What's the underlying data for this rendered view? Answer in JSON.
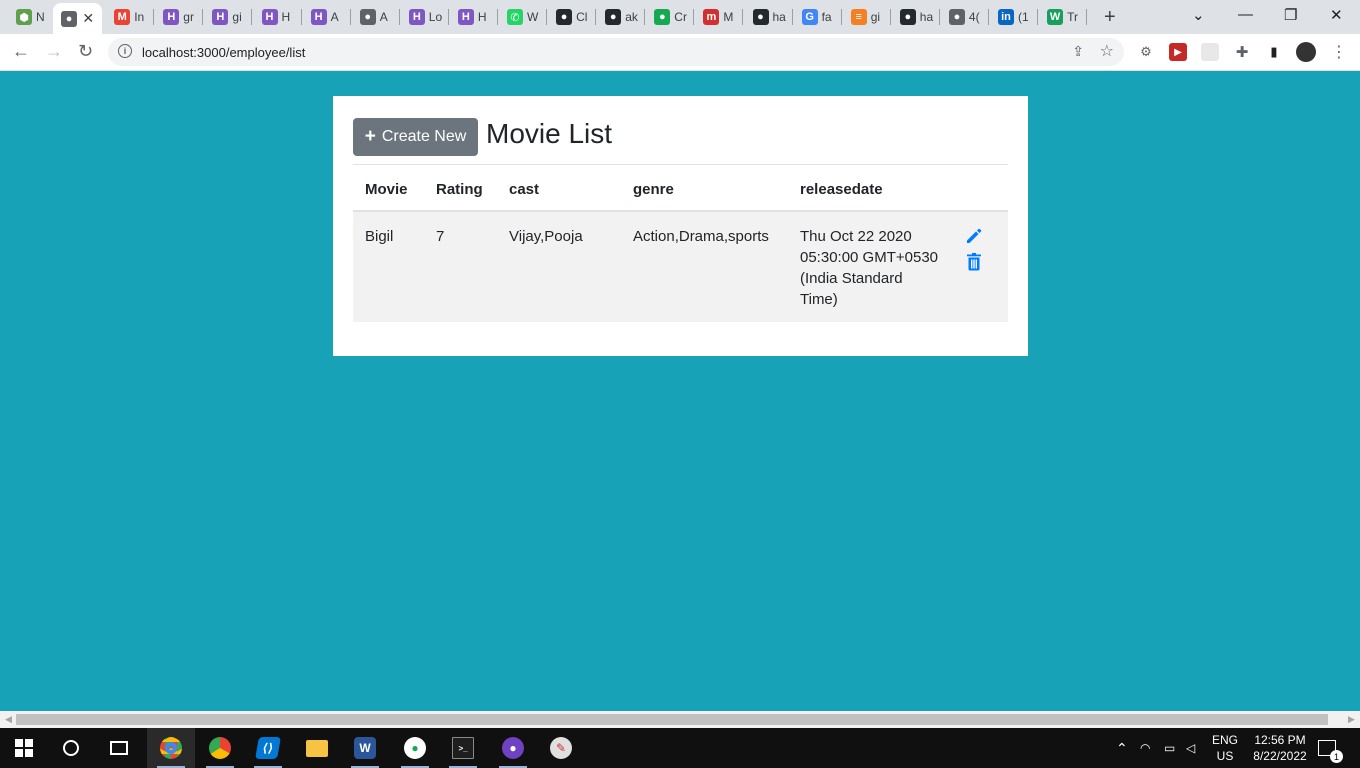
{
  "browser": {
    "tabs": [
      {
        "label": "N",
        "icon": "node-icon",
        "color": "#5fa04e",
        "glyph": "⬢"
      },
      {
        "label": "",
        "icon": "globe-icon",
        "color": "#5f6368",
        "glyph": "●",
        "active": true
      },
      {
        "label": "In",
        "icon": "gmail-icon",
        "color": "#ea4335",
        "glyph": "M"
      },
      {
        "label": "gr",
        "icon": "h-icon",
        "color": "#7e57c2",
        "glyph": "H"
      },
      {
        "label": "gi",
        "icon": "h-icon",
        "color": "#7e57c2",
        "glyph": "H"
      },
      {
        "label": "H",
        "icon": "h-icon",
        "color": "#7e57c2",
        "glyph": "H"
      },
      {
        "label": "A",
        "icon": "h-icon",
        "color": "#7e57c2",
        "glyph": "H"
      },
      {
        "label": "A",
        "icon": "globe-icon",
        "color": "#5f6368",
        "glyph": "●"
      },
      {
        "label": "Lo",
        "icon": "h-icon",
        "color": "#7e57c2",
        "glyph": "H"
      },
      {
        "label": "H",
        "icon": "h-icon",
        "color": "#7e57c2",
        "glyph": "H"
      },
      {
        "label": "W",
        "icon": "whatsapp-icon",
        "color": "#25d366",
        "glyph": "✆"
      },
      {
        "label": "Cl",
        "icon": "github-icon",
        "color": "#24292e",
        "glyph": "●"
      },
      {
        "label": "ak",
        "icon": "github-icon",
        "color": "#24292e",
        "glyph": "●"
      },
      {
        "label": "Cr",
        "icon": "mongodb-icon",
        "color": "#13aa52",
        "glyph": "●"
      },
      {
        "label": "M",
        "icon": "medium-icon",
        "color": "#d32f2f",
        "glyph": "m"
      },
      {
        "label": "ha",
        "icon": "github-icon",
        "color": "#24292e",
        "glyph": "●"
      },
      {
        "label": "fa",
        "icon": "google-icon",
        "color": "#4285f4",
        "glyph": "G"
      },
      {
        "label": "gi",
        "icon": "stackoverflow-icon",
        "color": "#f48024",
        "glyph": "≡"
      },
      {
        "label": "ha",
        "icon": "github-icon",
        "color": "#24292e",
        "glyph": "●"
      },
      {
        "label": "4(",
        "icon": "globe-icon",
        "color": "#5f6368",
        "glyph": "●"
      },
      {
        "label": "(1",
        "icon": "linkedin-icon",
        "color": "#0a66c2",
        "glyph": "in"
      },
      {
        "label": "Tr",
        "icon": "w-icon",
        "color": "#1a9e5c",
        "glyph": "W"
      }
    ],
    "url": "localhost:3000/employee/list"
  },
  "page": {
    "create_button": "Create New",
    "title": "Movie List",
    "table": {
      "headers": [
        "Movie",
        "Rating",
        "cast",
        "genre",
        "releasedate"
      ],
      "rows": [
        {
          "movie": "Bigil",
          "rating": "7",
          "cast": "Vijay,Pooja",
          "genre": "Action,Drama,sports",
          "releasedate": "Thu Oct 22 2020 05:30:00 GMT+0530 (India Standard Time)"
        }
      ]
    },
    "colors": {
      "background": "#17a2b8",
      "button": "#6c757d",
      "action_icon": "#007bff"
    }
  },
  "taskbar": {
    "language": "ENG",
    "region": "US",
    "time": "12:56 PM",
    "date": "8/22/2022",
    "notifications": "1"
  }
}
